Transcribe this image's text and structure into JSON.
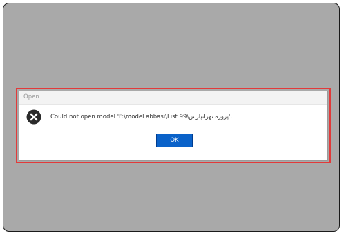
{
  "dialog": {
    "title": "Open",
    "message": "Could not open model 'F:\\model abbasi\\List 99\\پروژه تهرانپارس'.",
    "ok_label": "OK",
    "icon": "error-x-icon"
  },
  "colors": {
    "backdrop": "#a9a9a9",
    "highlight_border": "#e23a3a",
    "ok_button": "#0a62c9",
    "error_icon": "#2b2b2b"
  }
}
